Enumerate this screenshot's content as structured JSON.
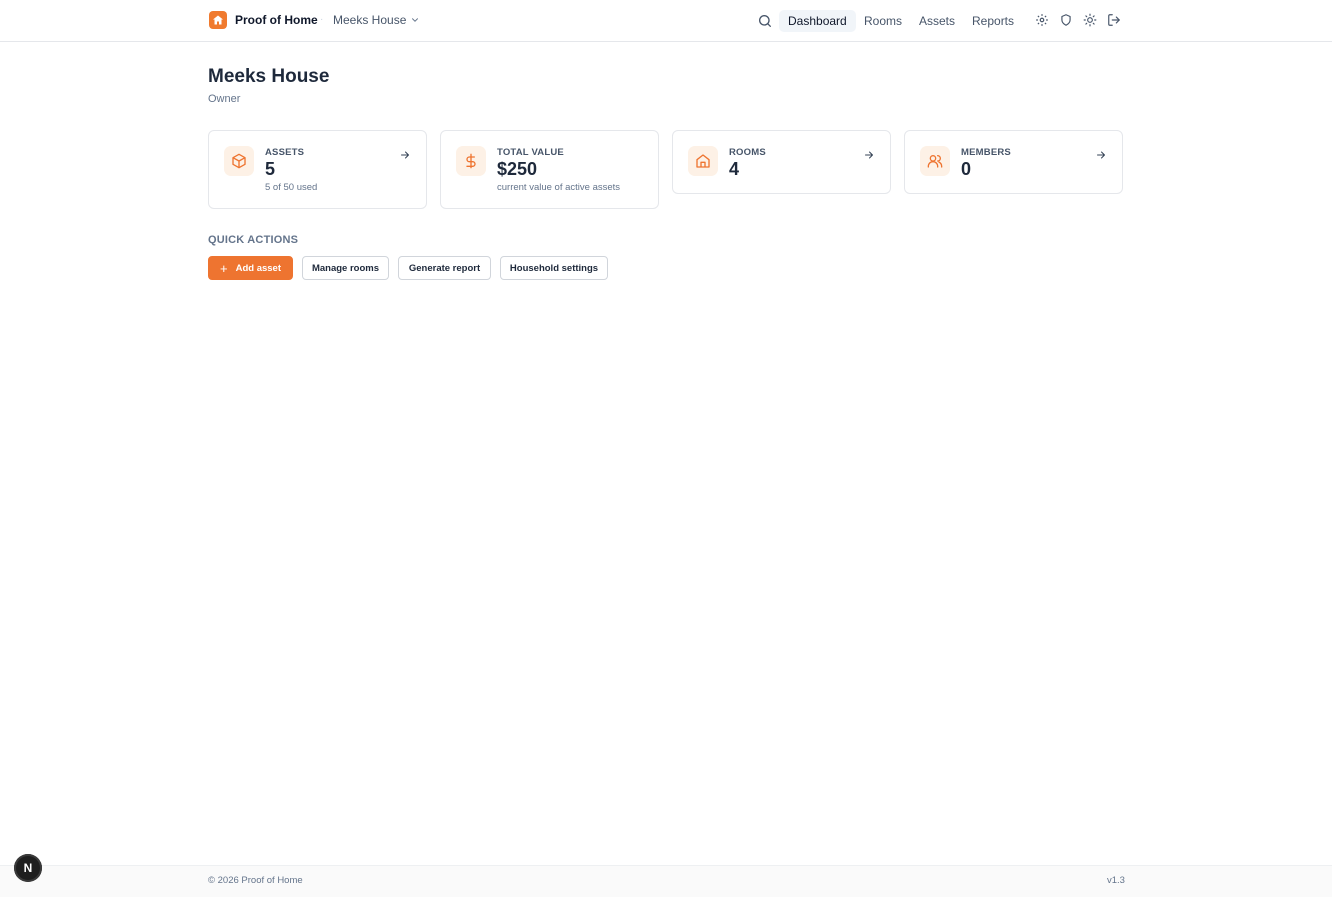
{
  "brand": {
    "name": "Proof of Home",
    "accent": "#ee7430"
  },
  "household": {
    "name": "Meeks House"
  },
  "nav": {
    "links": [
      {
        "label": "Dashboard",
        "active": true
      },
      {
        "label": "Rooms",
        "active": false
      },
      {
        "label": "Assets",
        "active": false
      },
      {
        "label": "Reports",
        "active": false
      }
    ],
    "icons": [
      "search-icon",
      "settings-icon",
      "shield-icon",
      "sun-icon",
      "logout-icon"
    ]
  },
  "page": {
    "title": "Meeks House",
    "subtitle": "Owner"
  },
  "stats": [
    {
      "icon": "box-icon",
      "label": "ASSETS",
      "value": "5",
      "note": "5 of 50 used"
    },
    {
      "icon": "dollar-icon",
      "label": "TOTAL VALUE",
      "value": "$250",
      "note": "current value of active assets"
    },
    {
      "icon": "home-icon",
      "label": "ROOMS",
      "value": "4",
      "note": ""
    },
    {
      "icon": "users-icon",
      "label": "MEMBERS",
      "value": "0",
      "note": ""
    }
  ],
  "quick_actions": {
    "title": "QUICK ACTIONS",
    "buttons": [
      {
        "label": "Add asset",
        "primary": true
      },
      {
        "label": "Manage rooms",
        "primary": false
      },
      {
        "label": "Generate report",
        "primary": false
      },
      {
        "label": "Household settings",
        "primary": false
      }
    ]
  },
  "footer": {
    "copyright": "© 2026 Proof of Home",
    "version": "v1.3"
  },
  "dev_badge": {
    "letter": "N"
  }
}
